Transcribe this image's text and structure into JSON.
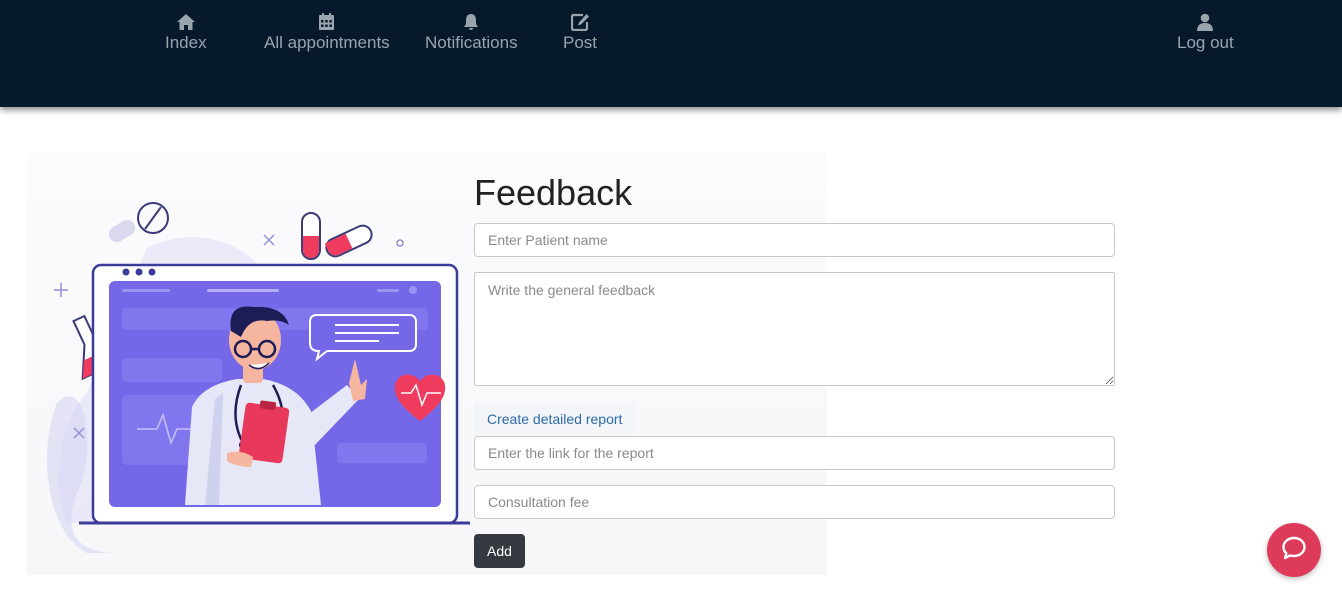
{
  "nav": {
    "items": [
      {
        "label": "Index",
        "icon": "home-icon"
      },
      {
        "label": "All appointments",
        "icon": "calendar-icon"
      },
      {
        "label": "Notifications",
        "icon": "bell-icon"
      },
      {
        "label": "Post",
        "icon": "edit-icon"
      }
    ],
    "logout": {
      "label": "Log out",
      "icon": "user-icon"
    },
    "colors": {
      "background": "#061a2c",
      "text": "#9aa4ad"
    }
  },
  "form": {
    "title": "Feedback",
    "patient_name_placeholder": "Enter Patient name",
    "feedback_placeholder": "Write the general feedback",
    "report_button_label": "Create detailed report",
    "report_link_placeholder": "Enter the link for the report",
    "fee_placeholder": "Consultation fee",
    "add_label": "Add"
  },
  "chat": {
    "icon": "chat-bubble-icon",
    "color": "#de3a5a"
  },
  "illustration": {
    "subject": "doctor-video-consultation-illustration"
  }
}
